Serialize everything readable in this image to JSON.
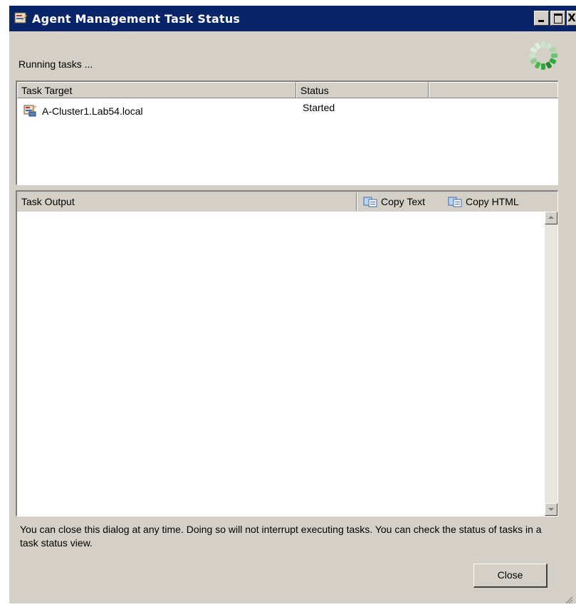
{
  "window": {
    "title": "Agent Management Task Status",
    "close_glyph": "X"
  },
  "status_text": "Running tasks ...",
  "task_list": {
    "columns": [
      "Task Target",
      "Status",
      ""
    ],
    "rows": [
      {
        "target": "A-Cluster1.Lab54.local",
        "status": "Started"
      }
    ]
  },
  "output": {
    "title": "Task Output",
    "copy_text_label": "Copy Text",
    "copy_html_label": "Copy HTML"
  },
  "info_message": "You can close this dialog at any time.  Doing so will not interrupt executing tasks.  You can check the status of tasks in a task status view.",
  "buttons": {
    "close_label": "Close"
  },
  "colors": {
    "titlebar": "#0a246a",
    "dialog_bg": "#d4d0c8",
    "spinner": "#2eaa3c"
  },
  "icons": {
    "title": "task-app-icon",
    "row": "computer-task-icon",
    "copy": "copy-icon",
    "busy": "busy-spinner-icon"
  }
}
